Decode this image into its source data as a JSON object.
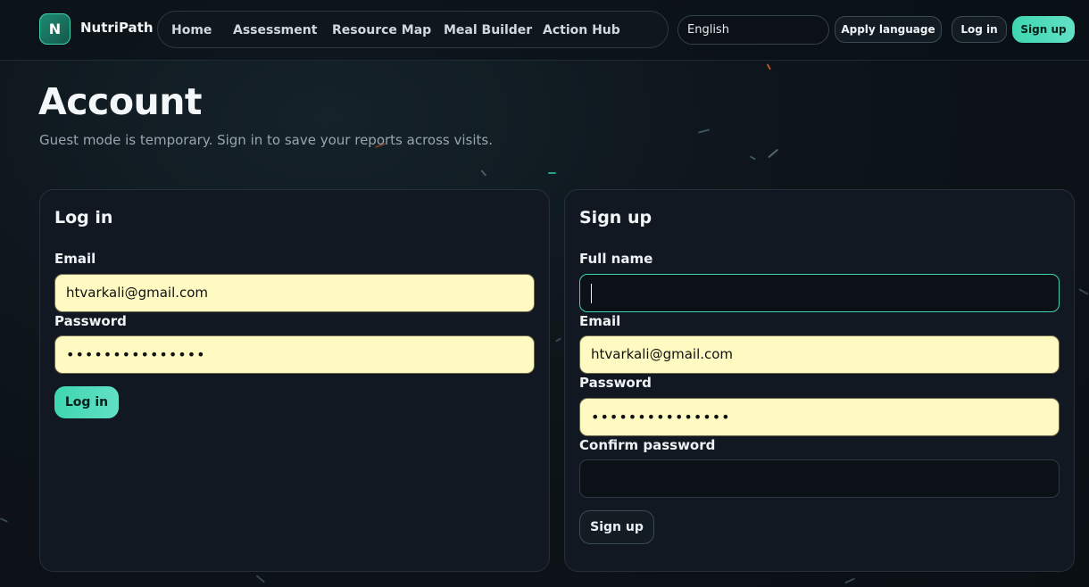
{
  "header": {
    "logo_letter": "N",
    "brand": "NutriPath",
    "nav": [
      "Home",
      "Assessment",
      "Resource Map",
      "Meal Builder",
      "Action Hub"
    ],
    "language_value": "English",
    "apply_language": "Apply language",
    "login": "Log in",
    "signup": "Sign up"
  },
  "page": {
    "title": "Account",
    "subtitle": "Guest mode is temporary. Sign in to save your reports across visits."
  },
  "login_card": {
    "title": "Log in",
    "email_label": "Email",
    "email_value": "htvarkali@gmail.com",
    "password_label": "Password",
    "password_value": "•••••••••••••••",
    "button": "Log in"
  },
  "signup_card": {
    "title": "Sign up",
    "fullname_label": "Full name",
    "fullname_value": "",
    "email_label": "Email",
    "email_value": "htvarkali@gmail.com",
    "password_label": "Password",
    "password_value": "•••••••••••••••",
    "confirm_label": "Confirm password",
    "confirm_value": "",
    "button": "Sign up"
  },
  "colors": {
    "accent": "#3fd6b0",
    "autofill": "#fefac2",
    "background": "#0d141a",
    "card": "#121821"
  }
}
